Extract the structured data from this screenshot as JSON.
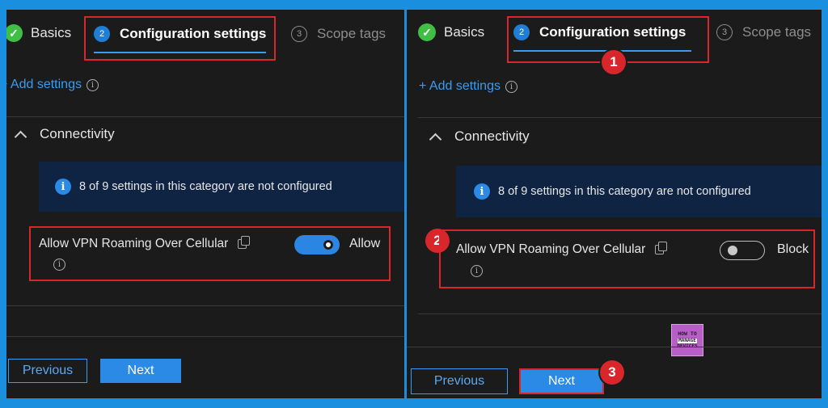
{
  "steps": {
    "basics": "Basics",
    "configuration": {
      "number": "2",
      "label": "Configuration settings"
    },
    "scope": {
      "number": "3",
      "label": "Scope tags"
    }
  },
  "add_settings": "+ Add settings",
  "info_glyph": "i",
  "section_title": "Connectivity",
  "banner_text": "8 of 9 settings in this category are not configured",
  "setting_label": "Allow VPN Roaming Over Cellular",
  "left_state": "Allow",
  "right_state": "Block",
  "toggles": {
    "left_on": true,
    "right_on": false
  },
  "buttons": {
    "previous": "Previous",
    "next": "Next"
  },
  "callouts": [
    "1",
    "2",
    "3"
  ],
  "logo": {
    "line1": "HOW TO",
    "line2": "MANAGE",
    "line3": "DEVICES"
  },
  "colors": {
    "frame": "#1a8fe0",
    "accent": "#2b8ae6",
    "highlight": "#d8262b",
    "success": "#3fbf44"
  }
}
